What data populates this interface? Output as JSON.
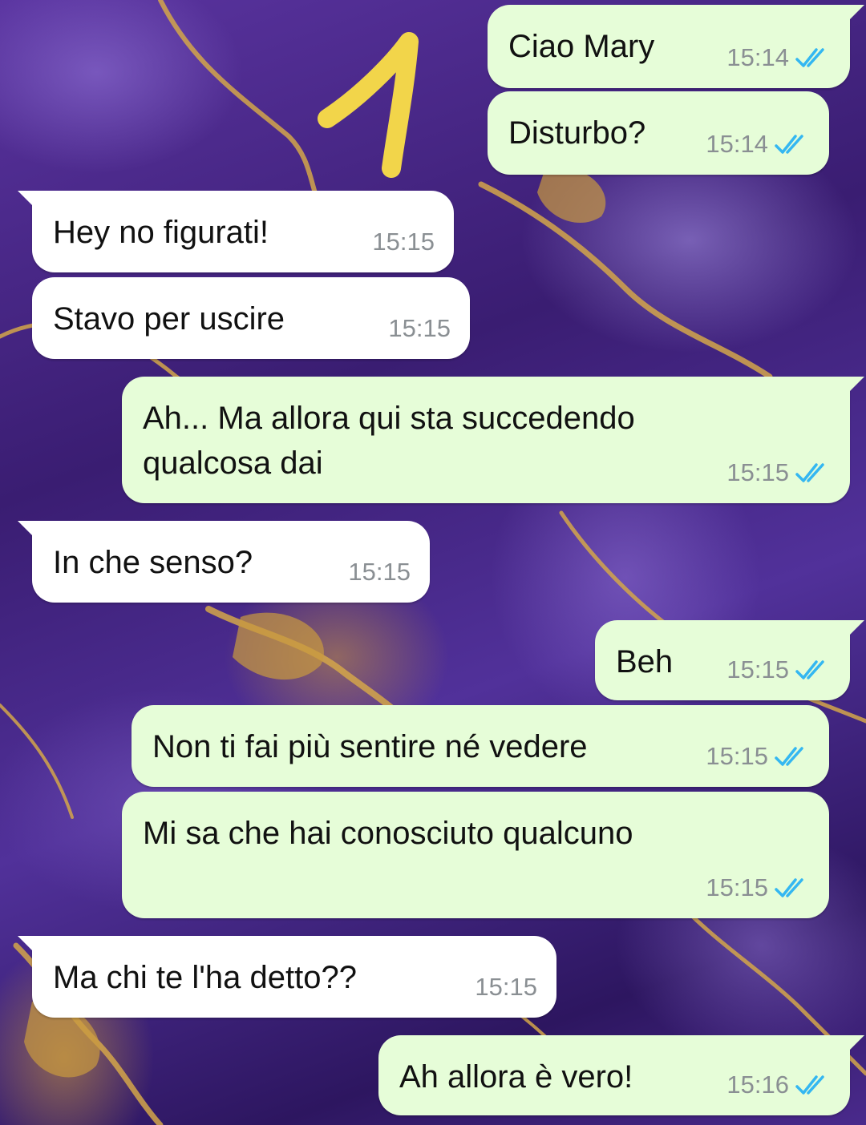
{
  "colors": {
    "outgoing_bubble": "#e6fdd8",
    "incoming_bubble": "#ffffff",
    "read_ticks": "#34b7f1",
    "annotation": "#f2d54a"
  },
  "annotation_number": "1",
  "messages": [
    {
      "direction": "outgoing",
      "text": "Ciao Mary",
      "time": "15:14",
      "status_icon": "double-check-read-icon"
    },
    {
      "direction": "outgoing",
      "text": "Disturbo?",
      "time": "15:14",
      "status_icon": "double-check-read-icon"
    },
    {
      "direction": "incoming",
      "text": "Hey no figurati!",
      "time": "15:15"
    },
    {
      "direction": "incoming",
      "text": "Stavo per uscire",
      "time": "15:15"
    },
    {
      "direction": "outgoing",
      "text": "Ah... Ma allora qui sta succedendo qualcosa dai",
      "time": "15:15",
      "status_icon": "double-check-read-icon"
    },
    {
      "direction": "incoming",
      "text": "In che senso?",
      "time": "15:15"
    },
    {
      "direction": "outgoing",
      "text": "Beh",
      "time": "15:15",
      "status_icon": "double-check-read-icon"
    },
    {
      "direction": "outgoing",
      "text": "Non ti fai più sentire né vedere",
      "time": "15:15",
      "status_icon": "double-check-read-icon"
    },
    {
      "direction": "outgoing",
      "text": "Mi sa che hai conosciuto qualcuno",
      "time": "15:15",
      "status_icon": "double-check-read-icon"
    },
    {
      "direction": "incoming",
      "text": "Ma chi te l'ha detto??",
      "time": "15:15"
    },
    {
      "direction": "outgoing",
      "text": "Ah allora è vero!",
      "time": "15:16",
      "status_icon": "double-check-read-icon"
    }
  ]
}
